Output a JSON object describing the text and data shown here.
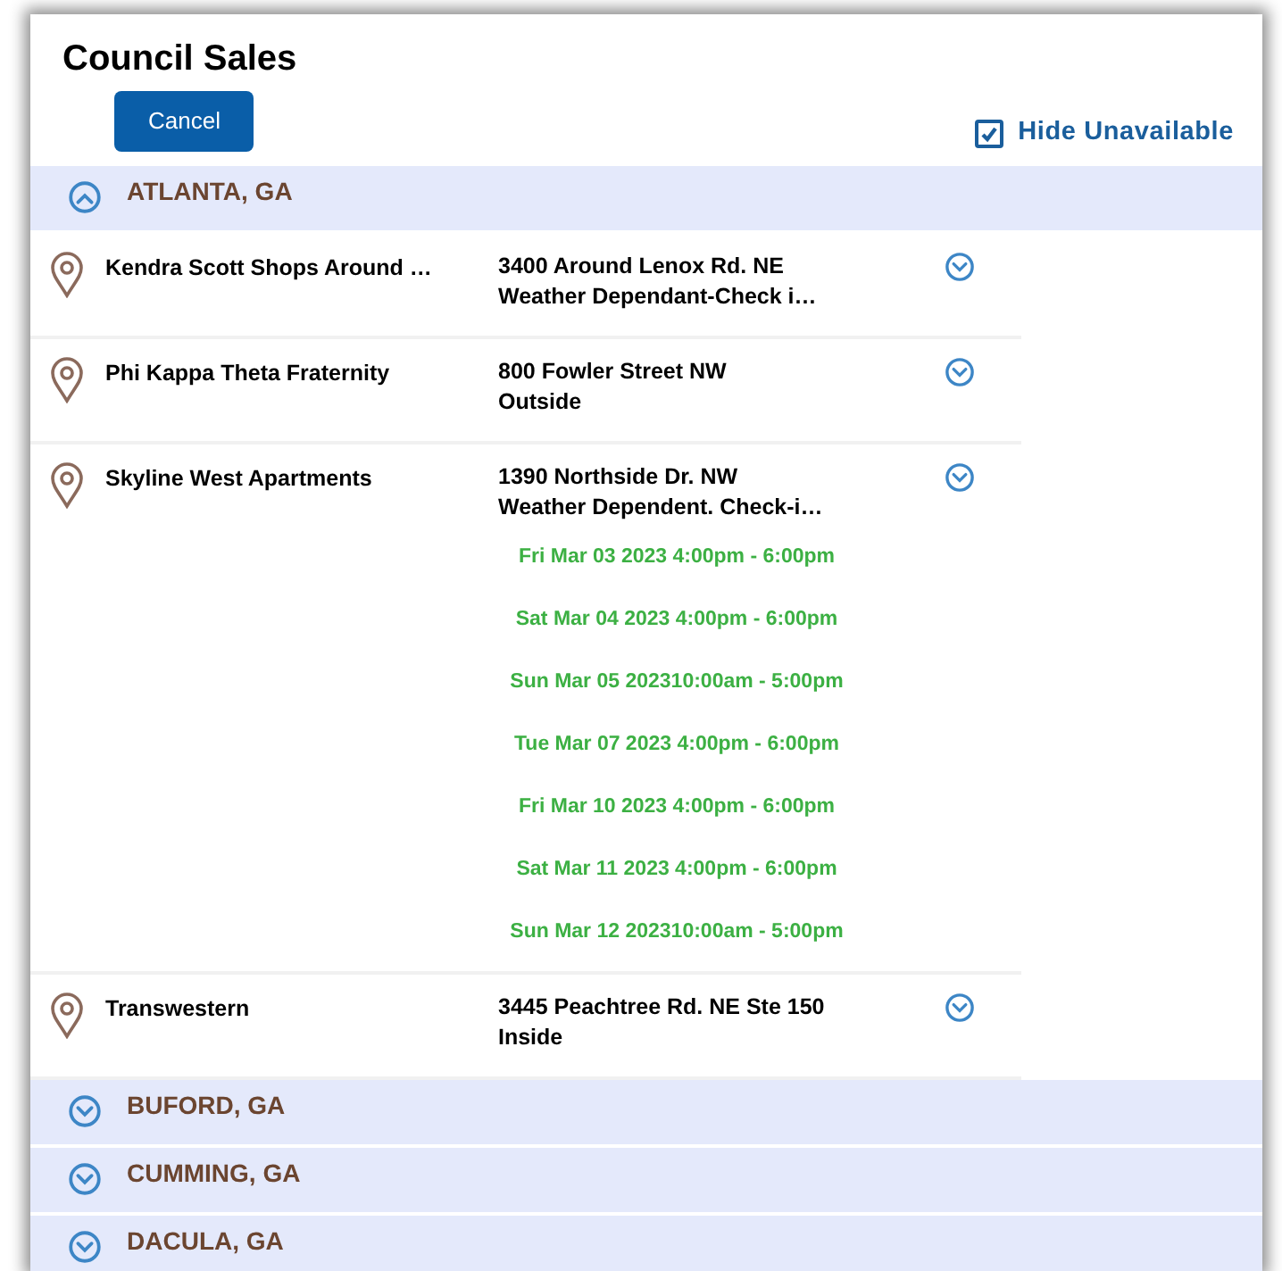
{
  "title": "Council Sales",
  "cancel_button": "Cancel",
  "hide_unavailable": {
    "label": "Hide Unavailable",
    "checked": true
  },
  "groups": [
    {
      "name": "ATLANTA, GA",
      "expanded": true,
      "locations": [
        {
          "name": "Kendra Scott Shops Around …",
          "address": "3400 Around Lenox Rd. NE",
          "note": "Weather Dependant-Check i…"
        },
        {
          "name": "Phi Kappa Theta Fraternity",
          "address": "800 Fowler Street NW",
          "note": "Outside"
        },
        {
          "name": "Skyline West Apartments",
          "address": "1390 Northside Dr. NW",
          "note": "Weather Dependent. Check-i…",
          "dates": [
            "Fri Mar 03 2023 4:00pm - 6:00pm",
            "Sat Mar 04 2023 4:00pm - 6:00pm",
            "Sun Mar 05 202310:00am - 5:00pm",
            "Tue Mar 07 2023 4:00pm - 6:00pm",
            "Fri Mar 10 2023 4:00pm - 6:00pm",
            "Sat Mar 11 2023 4:00pm - 6:00pm",
            "Sun Mar 12 202310:00am - 5:00pm"
          ]
        },
        {
          "name": "Transwestern",
          "address": "3445 Peachtree Rd. NE Ste 150",
          "note": "Inside"
        }
      ]
    },
    {
      "name": "BUFORD, GA",
      "expanded": false
    },
    {
      "name": "CUMMING, GA",
      "expanded": false
    },
    {
      "name": "DACULA, GA",
      "expanded": false
    }
  ]
}
